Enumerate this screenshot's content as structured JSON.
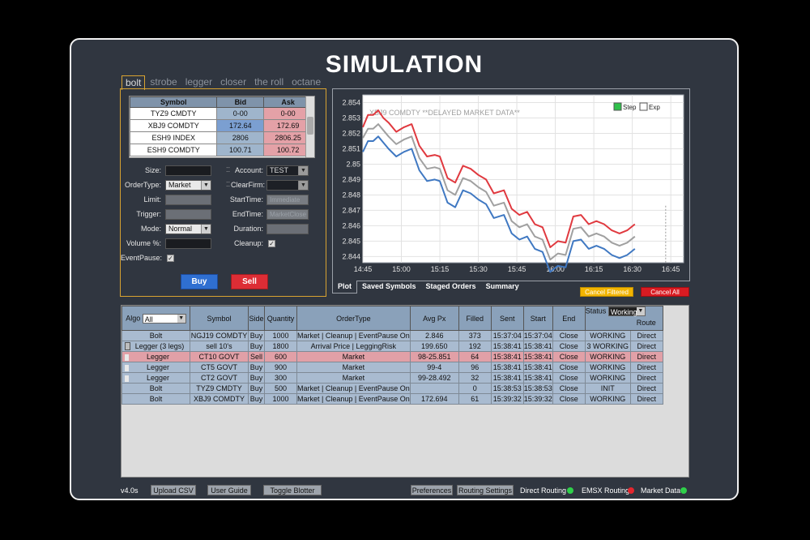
{
  "title": "SIMULATION",
  "algo_tabs": [
    "bolt",
    "strobe",
    "legger",
    "closer",
    "the roll",
    "octane"
  ],
  "quote_table": {
    "headers": [
      "Symbol",
      "Bid",
      "Ask"
    ],
    "rows": [
      {
        "symbol": "TYZ9 CMDTY",
        "bid": "0-00",
        "ask": "0-00"
      },
      {
        "symbol": "XBJ9 COMDTY",
        "bid": "172.64",
        "ask": "172.69"
      },
      {
        "symbol": "ESH9 INDEX",
        "bid": "2806",
        "ask": "2806.25"
      },
      {
        "symbol": "ESH9 COMDTY",
        "bid": "100.71",
        "ask": "100.72"
      }
    ]
  },
  "form": {
    "size_label": "Size:",
    "ordertype_label": "OrderType:",
    "ordertype_value": "Market",
    "limit_label": "Limit:",
    "trigger_label": "Trigger:",
    "mode_label": "Mode:",
    "mode_value": "Normal",
    "volume_label": "Volume %:",
    "eventpause_label": "EventPause:",
    "account_label": "Account:",
    "account_value": "TEST",
    "clearfirm_label": "ClearFirm:",
    "starttime_label": "StartTime:",
    "starttime_placeholder": "Immediate",
    "endtime_label": "EndTime:",
    "endtime_placeholder": "MarketClose",
    "duration_label": "Duration:",
    "cleanup_label": "Cleanup:",
    "check_mark": "✓",
    "buy_label": "Buy",
    "sell_label": "Sell"
  },
  "chart_tabs": [
    "Plot",
    "Saved Symbols",
    "Staged Orders",
    "Summary"
  ],
  "chart_buttons": {
    "cancel_filtered": "Cancel Filtered",
    "cancel_all": "Cancel All"
  },
  "chart_data": {
    "type": "line",
    "annotation": "XBJ9 COMDTY **DELAYED MARKET DATA**",
    "legend": [
      {
        "label": "Step",
        "checked": true
      },
      {
        "label": "Exp",
        "checked": false
      }
    ],
    "legend_position": "top-right",
    "x_ticks": [
      "14:45",
      "15:00",
      "15:15",
      "15:30",
      "15:45",
      "16:00",
      "16:15",
      "16:30",
      "16:45"
    ],
    "y_ticks": [
      "2.854",
      "2.853",
      "2.852",
      "2.851",
      "2.85",
      "2.849",
      "2.848",
      "2.847",
      "2.846",
      "2.845",
      "2.844"
    ],
    "xlim_minutes": [
      0,
      125
    ],
    "ylim": [
      2.8436,
      2.8545
    ],
    "grid": true,
    "x_minutes": [
      0,
      2,
      4,
      6,
      8,
      10,
      13,
      16,
      19,
      22,
      25,
      28,
      30,
      33,
      36,
      39,
      42,
      45,
      48,
      51,
      55,
      58,
      61,
      64,
      67,
      70,
      73,
      76,
      79,
      82,
      85,
      88,
      91,
      94,
      97,
      100,
      103,
      106
    ],
    "series": [
      {
        "color": "#e0393f",
        "values": [
          2.8524,
          2.8532,
          2.8532,
          2.8535,
          2.853,
          2.8527,
          2.8521,
          2.8524,
          2.8526,
          2.8512,
          2.8505,
          2.8506,
          2.8505,
          2.8491,
          2.8488,
          2.8499,
          2.8497,
          2.8493,
          2.849,
          2.8481,
          2.8483,
          2.8471,
          2.8467,
          2.8469,
          2.8461,
          2.8459,
          2.8446,
          2.845,
          2.8449,
          2.8466,
          2.8467,
          2.8461,
          2.8463,
          2.8461,
          2.8457,
          2.8455,
          2.8457,
          2.8461
        ]
      },
      {
        "color": "#a0a0a0",
        "values": [
          2.8517,
          2.8523,
          2.8523,
          2.8526,
          2.8522,
          2.8518,
          2.8513,
          2.8516,
          2.8518,
          2.8504,
          2.8497,
          2.8498,
          2.8497,
          2.8483,
          2.848,
          2.8491,
          2.8489,
          2.8485,
          2.8482,
          2.8473,
          2.8475,
          2.8463,
          2.8459,
          2.8461,
          2.8453,
          2.8451,
          2.8438,
          2.8442,
          2.8441,
          2.8458,
          2.8459,
          2.8453,
          2.8455,
          2.8453,
          2.8449,
          2.8447,
          2.8449,
          2.8453
        ]
      },
      {
        "color": "#3f78c2",
        "values": [
          2.8508,
          2.8515,
          2.8515,
          2.8518,
          2.8514,
          2.851,
          2.8505,
          2.8508,
          2.851,
          2.8496,
          2.8489,
          2.849,
          2.8489,
          2.8475,
          2.8472,
          2.8483,
          2.8481,
          2.8477,
          2.8474,
          2.8465,
          2.8467,
          2.8455,
          2.8451,
          2.8453,
          2.8445,
          2.8443,
          2.843,
          2.8434,
          2.8433,
          2.845,
          2.8451,
          2.8445,
          2.8447,
          2.8445,
          2.8441,
          2.8439,
          2.8441,
          2.8445
        ]
      }
    ]
  },
  "blotter": {
    "algo_label": "Algo",
    "algo_filter": "All",
    "status_label": "Status",
    "status_filter": "Working",
    "headers": [
      "Symbol",
      "Side",
      "Quantity",
      "OrderType",
      "Avg Px",
      "Filled",
      "Sent",
      "Start",
      "End",
      "Route"
    ],
    "rows": [
      {
        "algo": "Bolt",
        "symbol": "NGJ19 COMDTY",
        "side": "Buy",
        "qty": "1000",
        "ordertype": "Market | Cleanup | EventPause On",
        "avgpx": "2.846",
        "filled": "373",
        "sent": "15:37:04",
        "start": "15:37:04",
        "end": "Close",
        "status": "WORKING",
        "route": "Direct",
        "hl": false,
        "tag": false
      },
      {
        "algo": "Legger (3 legs)",
        "symbol": "sell 10's",
        "side": "Buy",
        "qty": "1800",
        "ordertype": "Arrival Price | LeggingRisk",
        "avgpx": "199.650",
        "filled": "192",
        "sent": "15:38:41",
        "start": "15:38:41",
        "end": "Close",
        "status": "3 WORKING",
        "route": "Direct",
        "hl": false,
        "tag": true
      },
      {
        "algo": "Legger",
        "symbol": "CT10 GOVT",
        "side": "Sell",
        "qty": "600",
        "ordertype": "Market",
        "avgpx": "98-25.851",
        "filled": "64",
        "sent": "15:38:41",
        "start": "15:38:41",
        "end": "Close",
        "status": "WORKING",
        "route": "Direct",
        "hl": true,
        "tag": true
      },
      {
        "algo": "Legger",
        "symbol": "CT5 GOVT",
        "side": "Buy",
        "qty": "900",
        "ordertype": "Market",
        "avgpx": "99-4",
        "filled": "96",
        "sent": "15:38:41",
        "start": "15:38:41",
        "end": "Close",
        "status": "WORKING",
        "route": "Direct",
        "hl": false,
        "tag": true
      },
      {
        "algo": "Legger",
        "symbol": "CT2 GOVT",
        "side": "Buy",
        "qty": "300",
        "ordertype": "Market",
        "avgpx": "99-28.492",
        "filled": "32",
        "sent": "15:38:41",
        "start": "15:38:41",
        "end": "Close",
        "status": "WORKING",
        "route": "Direct",
        "hl": false,
        "tag": true
      },
      {
        "algo": "Bolt",
        "symbol": "TYZ9 CMDTY",
        "side": "Buy",
        "qty": "500",
        "ordertype": "Market | Cleanup | EventPause On",
        "avgpx": "",
        "filled": "0",
        "sent": "15:38:53",
        "start": "15:38:53",
        "end": "Close",
        "status": "INIT",
        "route": "Direct",
        "hl": false,
        "tag": false
      },
      {
        "algo": "Bolt",
        "symbol": "XBJ9 COMDTY",
        "side": "Buy",
        "qty": "1000",
        "ordertype": "Market | Cleanup | EventPause On",
        "avgpx": "172.694",
        "filled": "61",
        "sent": "15:39:32",
        "start": "15:39:32",
        "end": "Close",
        "status": "WORKING",
        "route": "Direct",
        "hl": false,
        "tag": false
      }
    ]
  },
  "footer": {
    "version": "v4.0s",
    "upload_csv": "Upload CSV",
    "user_guide": "User Guide",
    "toggle_blotter": "Toggle Blotter",
    "preferences": "Preferences",
    "routing_settings": "Routing Settings",
    "direct_routing": "Direct Routing",
    "emsx_routing": "EMSX Routing",
    "market_data": "Market Data"
  },
  "colors": {
    "direct_routing": "#2fd04a",
    "emsx_routing": "#e3262e",
    "market_data": "#2fd04a",
    "accent": "#d8a331"
  }
}
